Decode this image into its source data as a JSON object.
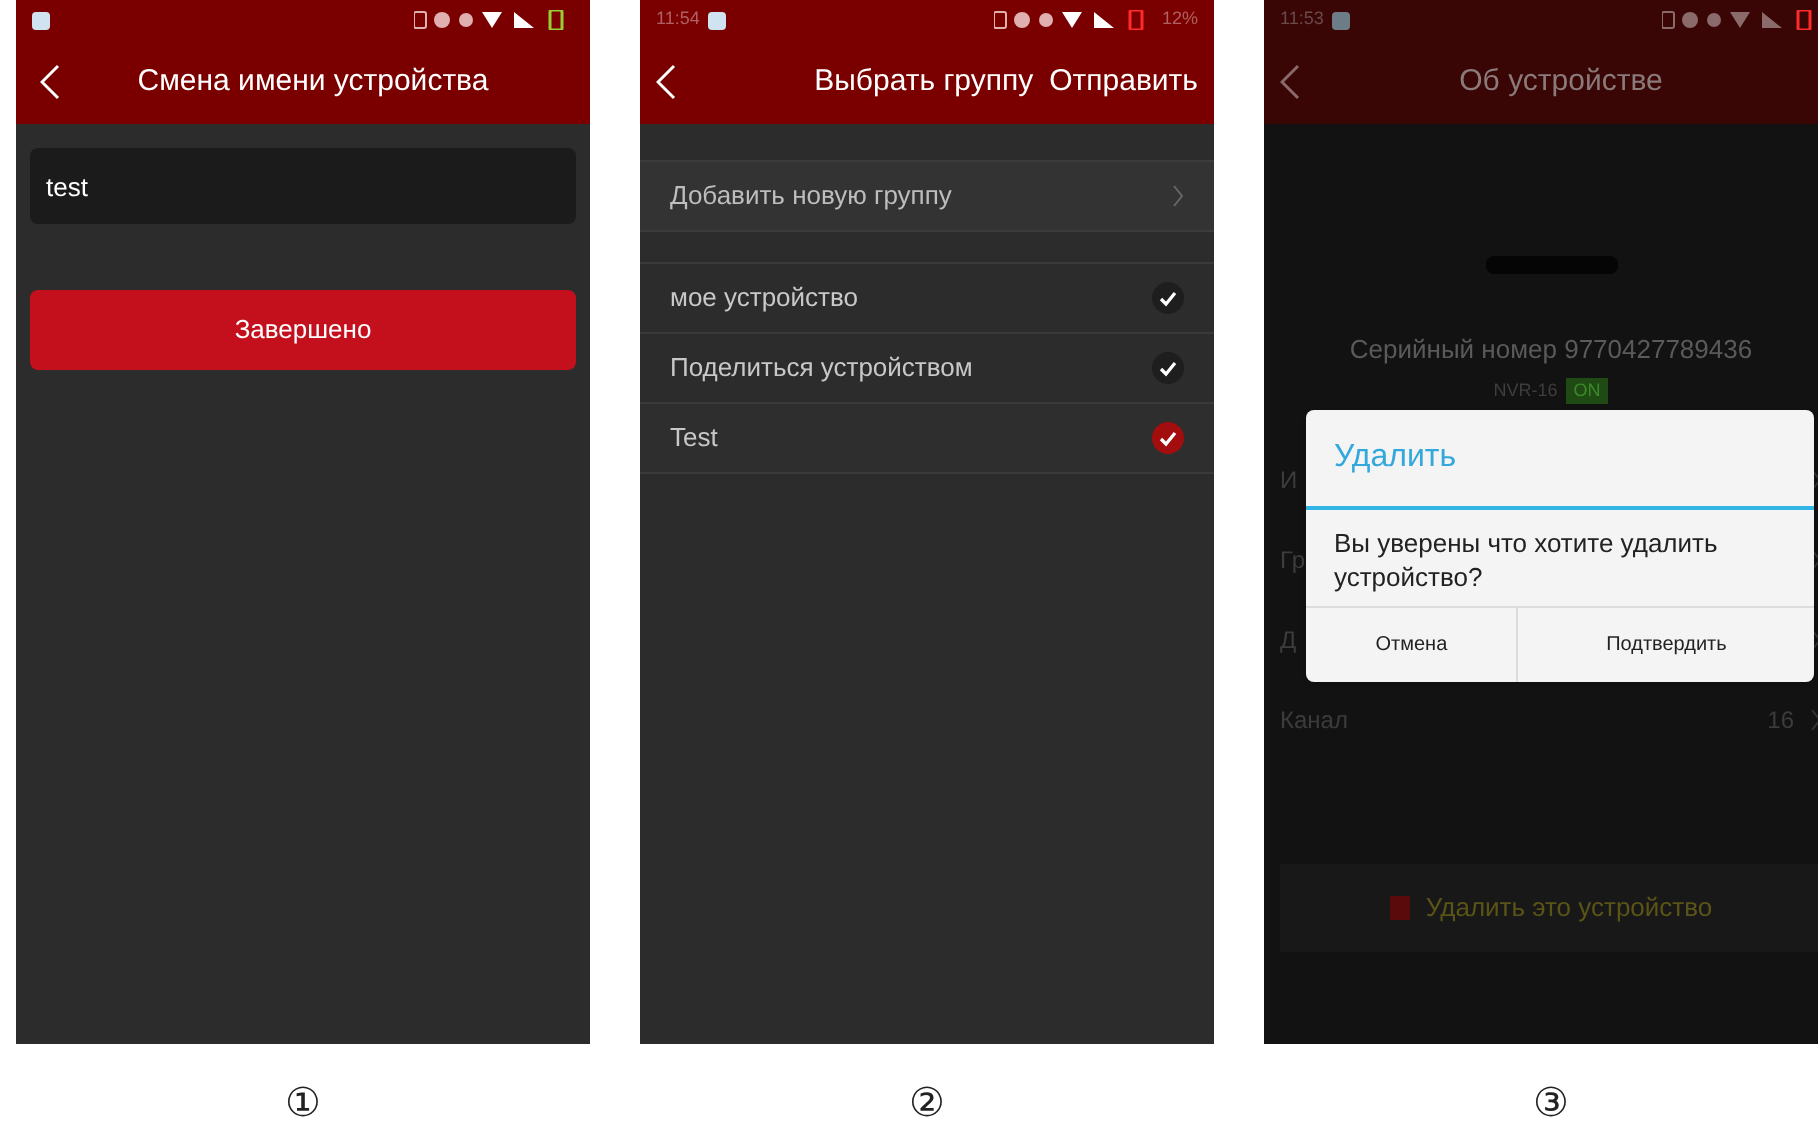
{
  "screens": [
    {
      "kind": "rename",
      "caption": "①",
      "title": "Смена имени устройства",
      "name_field": {
        "value": "test"
      },
      "button": "Завершено"
    },
    {
      "kind": "group",
      "caption": "②",
      "status_bar": {
        "time": "11:54",
        "battery": "12%"
      },
      "title": "Выбрать группу",
      "action": "Отправить",
      "add_row": "Добавить новую группу",
      "groups": [
        {
          "label": "мое устройство",
          "selected": false
        },
        {
          "label": "Поделиться устройством",
          "selected": false
        },
        {
          "label": "Test",
          "selected": true
        }
      ]
    },
    {
      "kind": "about",
      "caption": "③",
      "status_bar": {
        "time": "11:53"
      },
      "title": "Об устройстве",
      "serial": "Серийный номер 9770427789436",
      "model": "NVR-16",
      "online": "ON",
      "rows": [
        {
          "label": "И"
        },
        {
          "label": "Гр"
        },
        {
          "label": "Д"
        },
        {
          "label": "Канал",
          "value": "16"
        }
      ],
      "delete_button": "Удалить это устройство",
      "dialog": {
        "title": "Удалить",
        "message": "Вы уверены что хотите удалить устройство?",
        "buttons": [
          "Отмена",
          "Подтвердить"
        ]
      }
    }
  ]
}
